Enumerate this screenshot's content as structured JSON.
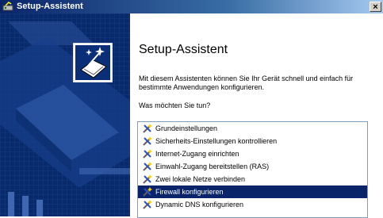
{
  "window": {
    "title": "Setup-Assistent",
    "close_glyph": "×"
  },
  "main": {
    "heading": "Setup-Assistent",
    "description": "Mit diesem Assistenten können Sie Ihr Gerät schnell und einfach für bestimmte Anwendungen konfigurieren.",
    "question": "Was möchten Sie tun?"
  },
  "tasks": [
    {
      "label": "Grundeinstellungen",
      "icon": "tools-icon",
      "selected": false
    },
    {
      "label": "Sicherheits-Einstellungen kontrollieren",
      "icon": "tools-icon",
      "selected": false
    },
    {
      "label": "Internet-Zugang einrichten",
      "icon": "tools-icon",
      "selected": false
    },
    {
      "label": "Einwahl-Zugang bereitstellen (RAS)",
      "icon": "tools-icon",
      "selected": false
    },
    {
      "label": "Zwei lokale Netze verbinden",
      "icon": "tools-icon",
      "selected": false
    },
    {
      "label": "Firewall konfigurieren",
      "icon": "tools-icon",
      "selected": true
    },
    {
      "label": "Dynamic DNS konfigurieren",
      "icon": "tools-icon",
      "selected": false
    }
  ],
  "colors": {
    "selection": "#0a246a",
    "panel": "#082a6b",
    "titlebar": "#0a246a"
  }
}
